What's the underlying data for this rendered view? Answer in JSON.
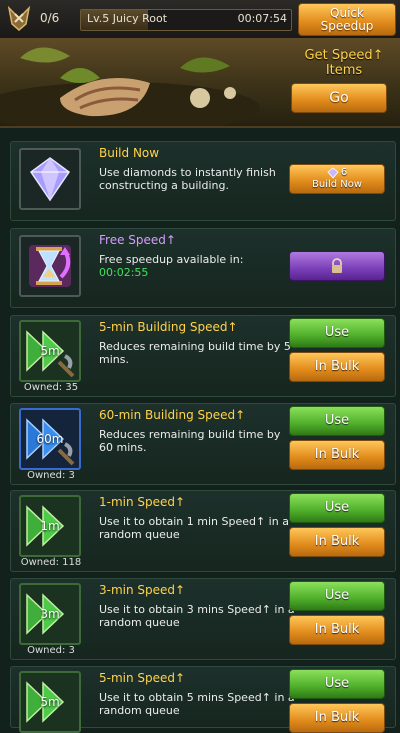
{
  "top_bar": {
    "queue_count": "0/6",
    "queue_label": "Lv.5 Juicy Root",
    "queue_timer": "00:07:54",
    "quick_speedup_label": "Quick Speedup"
  },
  "banner": {
    "title": "Get Speed↑ Items",
    "go_label": "Go"
  },
  "items": [
    {
      "name": "Build Now",
      "desc": "Use diamonds to instantly finish constructing a building.",
      "icon": "diamond-icon",
      "cost": "6",
      "button": "Build Now"
    },
    {
      "name": "Free Speed↑",
      "desc": "Free speedup available in:",
      "timer": "00:02:55",
      "icon": "hourglass-icon",
      "button_icon": "lock-icon"
    },
    {
      "name": "5-min Building Speed↑",
      "desc": "Reduces remaining build time by 5 mins.",
      "icon_label": "5m",
      "owned": "Owned: 35",
      "use": "Use",
      "bulk": "In Bulk"
    },
    {
      "name": "60-min Building Speed↑",
      "desc": "Reduces remaining build time by 60 mins.",
      "icon_label": "60m",
      "owned": "Owned: 3",
      "use": "Use",
      "bulk": "In Bulk"
    },
    {
      "name": "1-min Speed↑",
      "desc": "Use it to obtain 1 min Speed↑ in a random queue",
      "icon_label": "1m",
      "owned": "Owned: 118",
      "use": "Use",
      "bulk": "In Bulk"
    },
    {
      "name": "3-min Speed↑",
      "desc": "Use it to obtain 3 mins Speed↑ in a random queue",
      "icon_label": "3m",
      "owned": "Owned: 3",
      "use": "Use",
      "bulk": "In Bulk"
    },
    {
      "name": "5-min Speed↑",
      "desc": "Use it to obtain 5 mins Speed↑ in a random queue",
      "icon_label": "5m",
      "use": "Use",
      "bulk": "In Bulk"
    }
  ],
  "colors": {
    "accent_orange": "#e08a1a",
    "accent_green": "#4fae2a",
    "title_yellow": "#ffd34a",
    "free_speed_purple": "#d79bff",
    "timer_green": "#3fe35a"
  }
}
